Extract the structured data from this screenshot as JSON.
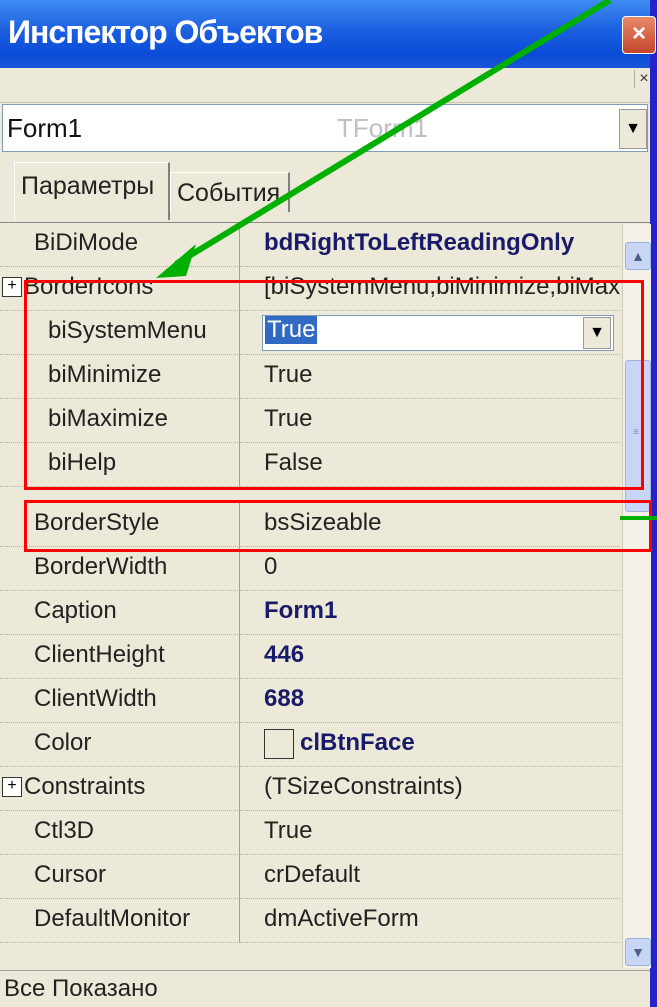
{
  "window": {
    "title": "Инспектор Объектов",
    "close_glyph": "×"
  },
  "strip": {
    "close_glyph": "×"
  },
  "object_selector": {
    "name": "Form1",
    "type": "TForm1",
    "dropdown_glyph": "▼"
  },
  "tabs": [
    {
      "label": "Параметры",
      "active": true
    },
    {
      "label": "События",
      "active": false
    }
  ],
  "properties": [
    {
      "name": "BiDiMode",
      "value": "bdRightToLeftReadingOnly",
      "bold": true,
      "indent": false,
      "expandable": false
    },
    {
      "name": "BorderIcons",
      "value": "[biSystemMenu,biMinimize,biMaximize",
      "bold": false,
      "indent": false,
      "expandable": true
    },
    {
      "name": "biSystemMenu",
      "value": "True",
      "bold": false,
      "indent": true,
      "expandable": false,
      "selected": true
    },
    {
      "name": "biMinimize",
      "value": "True",
      "bold": false,
      "indent": true,
      "expandable": false
    },
    {
      "name": "biMaximize",
      "value": "True",
      "bold": false,
      "indent": true,
      "expandable": false
    },
    {
      "name": "biHelp",
      "value": "False",
      "bold": false,
      "indent": true,
      "expandable": false
    },
    {
      "name": "BorderStyle",
      "value": "bsSizeable",
      "bold": false,
      "indent": false,
      "expandable": false
    },
    {
      "name": "BorderWidth",
      "value": "0",
      "bold": false,
      "indent": false,
      "expandable": false
    },
    {
      "name": "Caption",
      "value": "Form1",
      "bold": true,
      "indent": false,
      "expandable": false
    },
    {
      "name": "ClientHeight",
      "value": "446",
      "bold": true,
      "indent": false,
      "expandable": false
    },
    {
      "name": "ClientWidth",
      "value": "688",
      "bold": true,
      "indent": false,
      "expandable": false
    },
    {
      "name": "Color",
      "value": "clBtnFace",
      "bold": true,
      "indent": false,
      "expandable": false,
      "color_swatch": true
    },
    {
      "name": "Constraints",
      "value": "(TSizeConstraints)",
      "bold": false,
      "indent": false,
      "expandable": true
    },
    {
      "name": "Ctl3D",
      "value": "True",
      "bold": false,
      "indent": false,
      "expandable": false
    },
    {
      "name": "Cursor",
      "value": "crDefault",
      "bold": false,
      "indent": false,
      "expandable": false
    },
    {
      "name": "DefaultMonitor",
      "value": "dmActiveForm",
      "bold": false,
      "indent": false,
      "expandable": false
    }
  ],
  "dropdown_glyph": "▼",
  "expand_glyph": "+",
  "status": {
    "text": "Все Показано"
  },
  "colors": {
    "title_blue": "#0a4bd6",
    "highlight_red": "#ff0000",
    "arrow_green": "#00b000",
    "selection": "#316ac5"
  }
}
